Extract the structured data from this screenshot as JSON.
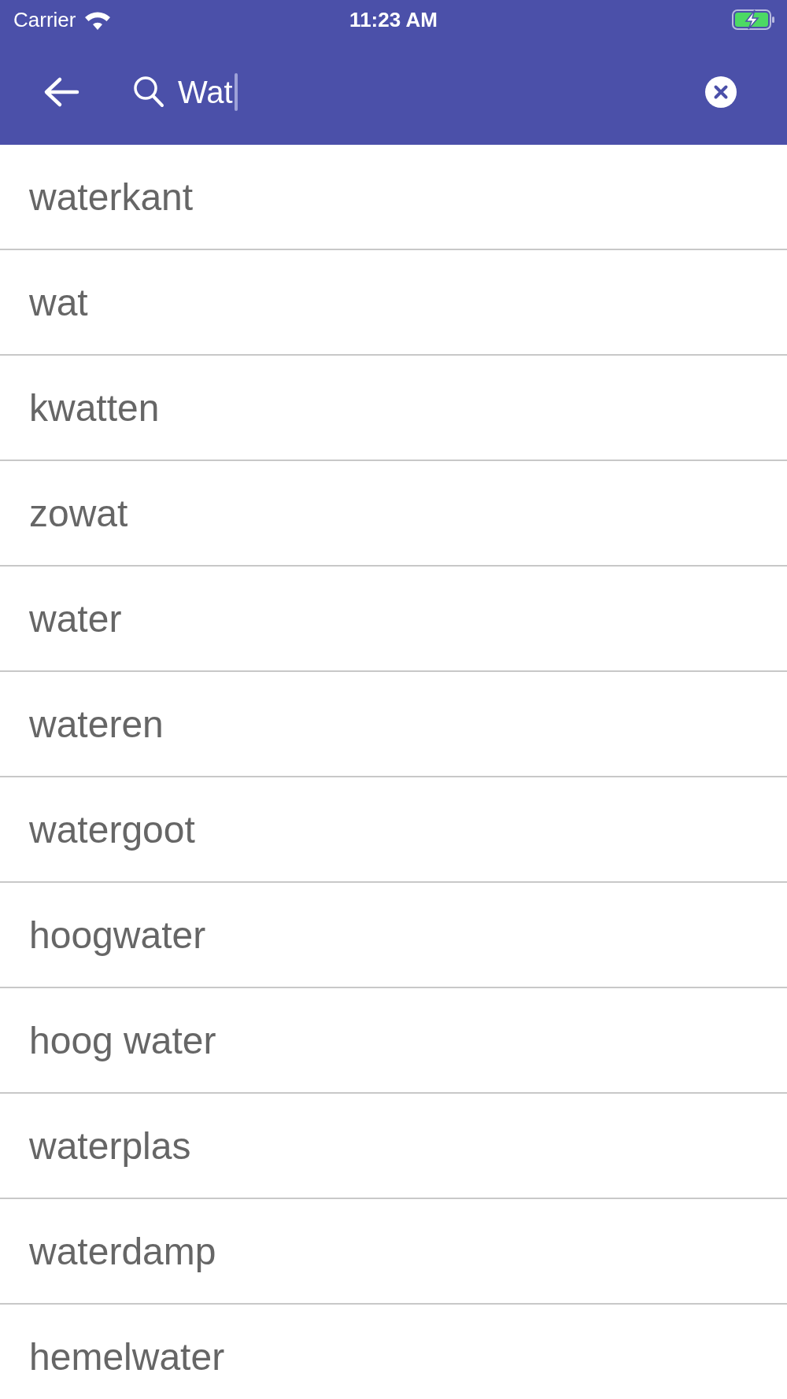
{
  "status_bar": {
    "carrier": "Carrier",
    "time": "11:23 AM",
    "charging": true
  },
  "search": {
    "value": "Wat"
  },
  "results": [
    "waterkant",
    "wat",
    "kwatten",
    "zowat",
    "water",
    "wateren",
    "watergoot",
    "hoogwater",
    "hoog water",
    "waterplas",
    "waterdamp",
    "hemelwater"
  ]
}
